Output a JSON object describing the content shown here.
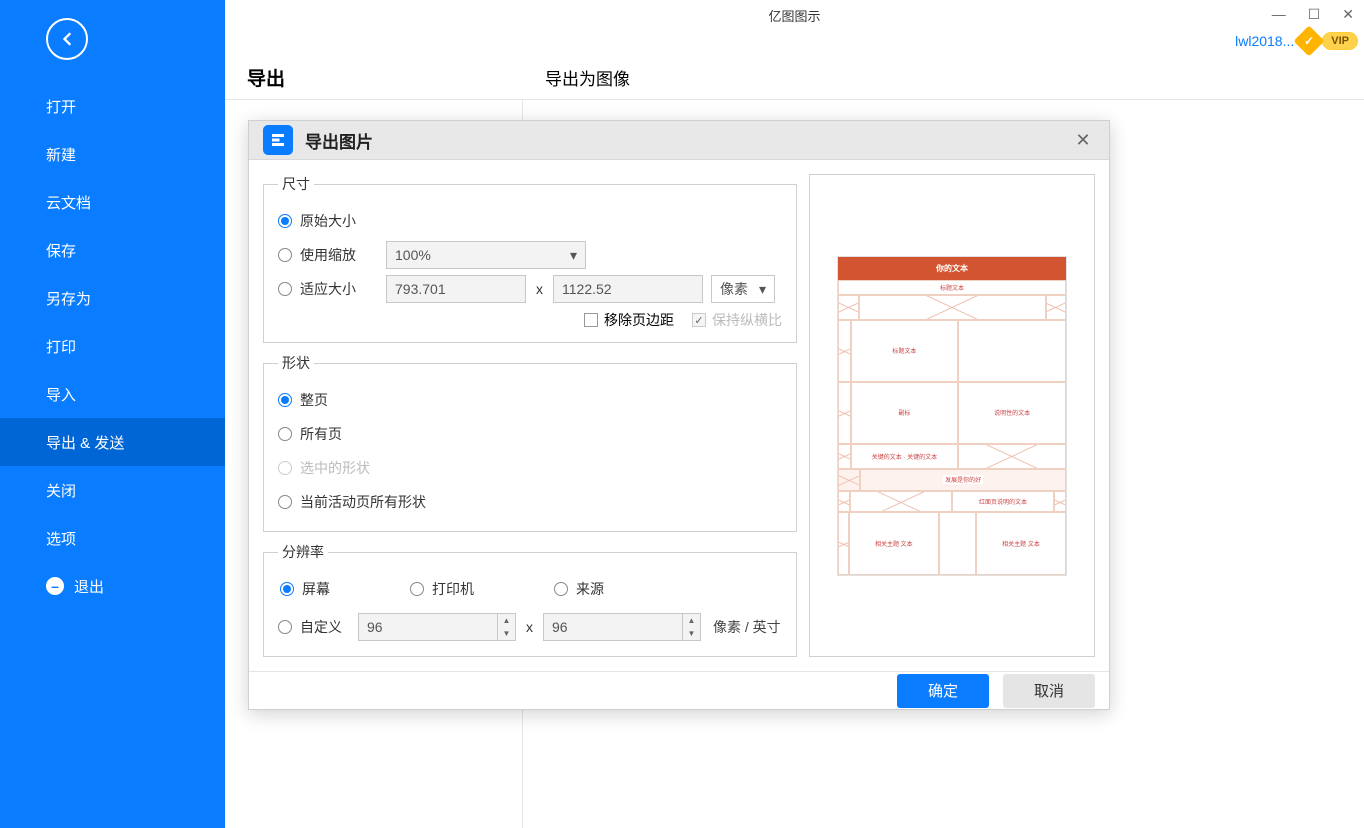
{
  "app_title": "亿图图示",
  "user": {
    "name": "lwl2018...",
    "vip": "VIP"
  },
  "sidebar": {
    "items": [
      {
        "label": "打开"
      },
      {
        "label": "新建"
      },
      {
        "label": "云文档"
      },
      {
        "label": "保存"
      },
      {
        "label": "另存为"
      },
      {
        "label": "打印"
      },
      {
        "label": "导入"
      },
      {
        "label": "导出 & 发送",
        "active": true
      },
      {
        "label": "关闭"
      },
      {
        "label": "选项"
      }
    ],
    "exit": "退出"
  },
  "page": {
    "heading": "导出",
    "subheading": "导出为图像"
  },
  "dialog": {
    "title": "导出图片",
    "size": {
      "legend": "尺寸",
      "original": "原始大小",
      "zoom": "使用缩放",
      "zoom_value": "100%",
      "fit": "适应大小",
      "width": "793.701",
      "height": "1122.52",
      "unit": "像素",
      "remove_margin": "移除页边距",
      "keep_ratio": "保持纵横比"
    },
    "shape": {
      "legend": "形状",
      "full": "整页",
      "all": "所有页",
      "selected": "选中的形状",
      "current": "当前活动页所有形状"
    },
    "res": {
      "legend": "分辨率",
      "screen": "屏幕",
      "printer": "打印机",
      "source": "来源",
      "custom": "自定义",
      "x": "96",
      "y": "96",
      "unit": "像素 / 英寸"
    },
    "ok": "确定",
    "cancel": "取消"
  },
  "preview": {
    "title": "你的文本"
  }
}
